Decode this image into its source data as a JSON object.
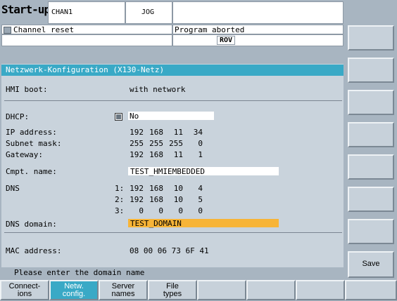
{
  "header": {
    "title": "Start-up",
    "channel": "CHAN1",
    "mode": "JOG",
    "reset_status": "Channel reset",
    "program_status": "Program aborted",
    "rov": "ROV"
  },
  "panel": {
    "title": "Netzwerk-Konfiguration (X130-Netz)",
    "hmi_boot_label": "HMI boot:",
    "hmi_boot_value": "with network",
    "dhcp_label": "DHCP:",
    "dhcp_value": "No",
    "ip_label": "IP address:",
    "ip": [
      "192",
      "168",
      "11",
      "34"
    ],
    "subnet_label": "Subnet mask:",
    "subnet": [
      "255",
      "255",
      "255",
      "0"
    ],
    "gateway_label": "Gateway:",
    "gateway": [
      "192",
      "168",
      "11",
      "1"
    ],
    "cmpt_label": "Cmpt. name:",
    "cmpt_value": "TEST_HMIEMBEDDED",
    "dns_label": "DNS",
    "dns": [
      {
        "index": "1:",
        "octets": [
          "192",
          "168",
          "10",
          "4"
        ]
      },
      {
        "index": "2:",
        "octets": [
          "192",
          "168",
          "10",
          "5"
        ]
      },
      {
        "index": "3:",
        "octets": [
          "0",
          "0",
          "0",
          "0"
        ]
      }
    ],
    "dns_domain_label": "DNS domain:",
    "dns_domain_value": "TEST_DOMAIN",
    "mac_label": "MAC address:",
    "mac_value": "08 00 06 73 6F 41"
  },
  "status_line": "Please enter the domain name",
  "vsoftkeys": {
    "save": "Save"
  },
  "hsoftkeys": [
    {
      "line1": "Connect-",
      "line2": "ions"
    },
    {
      "line1": "Netw.",
      "line2": "config."
    },
    {
      "line1": "Server",
      "line2": "names"
    },
    {
      "line1": "File",
      "line2": "types"
    }
  ],
  "colors": {
    "accent": "#39a9c6",
    "highlight": "#f7b437",
    "background": "#a8b5c1"
  }
}
